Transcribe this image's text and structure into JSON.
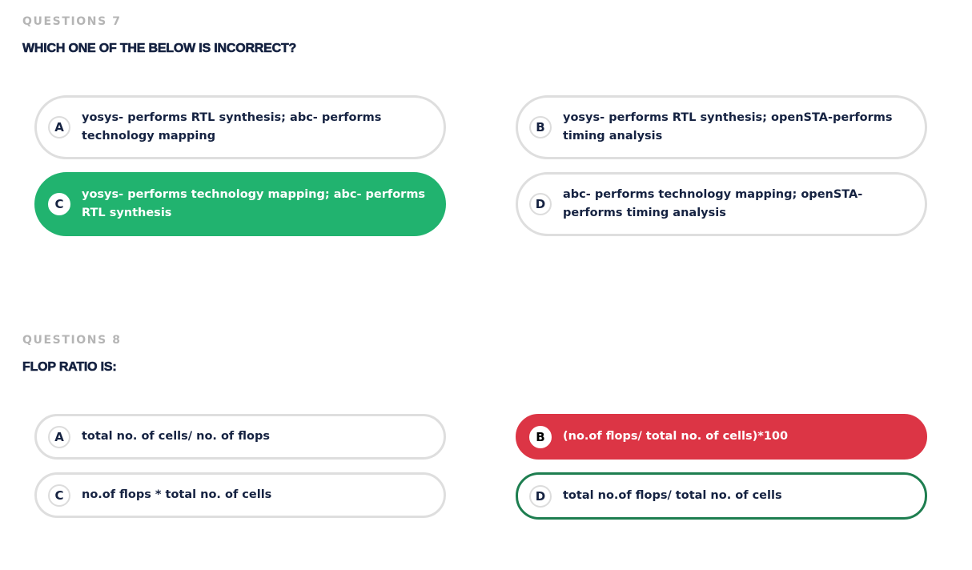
{
  "questions": [
    {
      "number_label": "QUESTIONS 7",
      "text": "WHICH ONE OF THE BELOW IS INCORRECT?",
      "options": [
        {
          "letter": "A",
          "text": "yosys- performs RTL synthesis; abc- performs technology mapping",
          "state": "default"
        },
        {
          "letter": "B",
          "text": "yosys- performs RTL synthesis; openSTA-performs timing analysis",
          "state": "default"
        },
        {
          "letter": "C",
          "text": "yosys- performs technology mapping; abc- performs RTL synthesis",
          "state": "correct-selected"
        },
        {
          "letter": "D",
          "text": "abc- performs technology mapping; openSTA-performs timing analysis",
          "state": "default"
        }
      ]
    },
    {
      "number_label": "QUESTIONS 8",
      "text": "FLOP RATIO IS:",
      "options": [
        {
          "letter": "A",
          "text": "total no. of cells/ no. of flops",
          "state": "default"
        },
        {
          "letter": "B",
          "text": "(no.of flops/ total no. of cells)*100",
          "state": "wrong-selected"
        },
        {
          "letter": "C",
          "text": "no.of flops * total no. of cells",
          "state": "default"
        },
        {
          "letter": "D",
          "text": "total no.of flops/ total no. of cells",
          "state": "correct-answer"
        }
      ]
    }
  ],
  "colors": {
    "correct": "#21b36f",
    "wrong": "#dc3545",
    "correct_outline": "#1e7e50",
    "heading": "#152241",
    "muted": "#b5b5b5"
  }
}
